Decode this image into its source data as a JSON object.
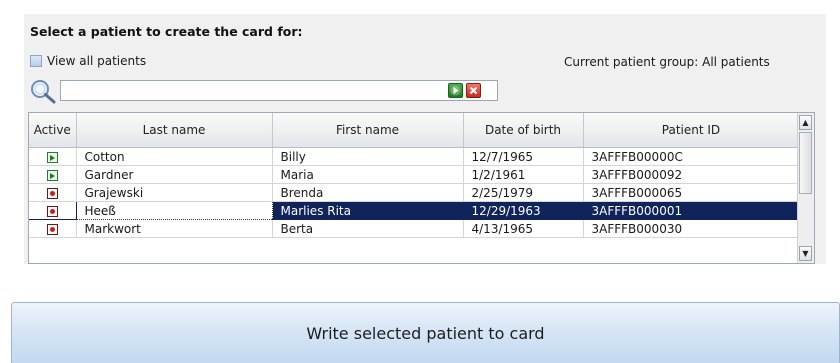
{
  "panel": {
    "title": "Select a patient to create the card for:",
    "view_all_label": "View all patients",
    "current_group_label": "Current patient group: All patients",
    "search": {
      "value": "",
      "placeholder": ""
    }
  },
  "table": {
    "columns": [
      "Active",
      "Last name",
      "First name",
      "Date of birth",
      "Patient ID"
    ],
    "rows": [
      {
        "status": "active",
        "last": "Cotton",
        "first": "Billy",
        "dob": "12/7/1965",
        "id": "3AFFFB00000C"
      },
      {
        "status": "active",
        "last": "Gardner",
        "first": "Maria",
        "dob": "1/2/1961",
        "id": "3AFFFB000092"
      },
      {
        "status": "inactive",
        "last": "Grajewski",
        "first": "Brenda",
        "dob": "2/25/1979",
        "id": "3AFFFB000065"
      },
      {
        "status": "inactive",
        "last": "Heeß",
        "first": "Marlies Rita",
        "dob": "12/29/1963",
        "id": "3AFFFB000001",
        "selected": true
      },
      {
        "status": "inactive",
        "last": "Markwort",
        "first": "Berta",
        "dob": "4/13/1965",
        "id": "3AFFFB000030"
      }
    ]
  },
  "icons": {
    "search": "magnifier-icon",
    "go": "go-arrow-icon",
    "clear": "clear-x-icon",
    "active": "active-arrow-icon",
    "inactive": "inactive-dot-icon"
  },
  "colors": {
    "selected_row": "#10235a",
    "button_fill": "#d6e6f6",
    "go": "#2f8f2f",
    "clear": "#d93a2a"
  },
  "write_button_label": "Write selected patient to card"
}
